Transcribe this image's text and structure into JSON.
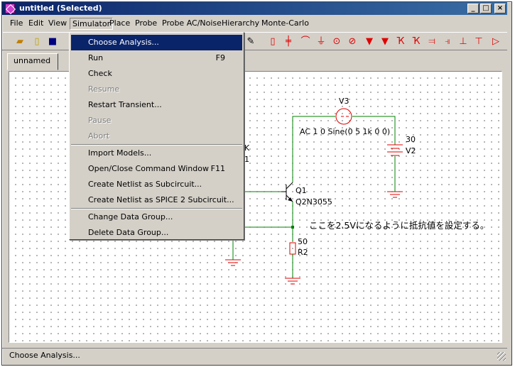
{
  "window": {
    "title": "untitled (Selected)"
  },
  "titlebar_buttons": {
    "minimize": "_",
    "maximize": "□",
    "close": "×"
  },
  "menubar": [
    "File",
    "Edit",
    "View",
    "Simulator",
    "Place",
    "Probe",
    "Probe AC/Noise",
    "Hierarchy",
    "Monte-Carlo"
  ],
  "tab": {
    "label": "unnamed"
  },
  "simulator_menu": {
    "items": [
      {
        "label": "Choose Analysis...",
        "shortcut": "",
        "state": "highlighted"
      },
      {
        "label": "Run",
        "shortcut": "F9",
        "state": "enabled"
      },
      {
        "label": "Check",
        "shortcut": "",
        "state": "enabled"
      },
      {
        "label": "Resume",
        "shortcut": "",
        "state": "disabled"
      },
      {
        "label": "Restart Transient...",
        "shortcut": "",
        "state": "enabled"
      },
      {
        "label": "Pause",
        "shortcut": "",
        "state": "disabled"
      },
      {
        "label": "Abort",
        "shortcut": "",
        "state": "disabled"
      },
      {
        "label": "Import Models...",
        "shortcut": "",
        "state": "enabled"
      },
      {
        "label": "Open/Close Command Window",
        "shortcut": "F11",
        "state": "enabled"
      },
      {
        "label": "Create Netlist as Subcircuit...",
        "shortcut": "",
        "state": "enabled"
      },
      {
        "label": "Create Netlist as SPICE 2 Subcircuit...",
        "shortcut": "",
        "state": "enabled"
      },
      {
        "label": "Change Data Group...",
        "shortcut": "",
        "state": "enabled"
      },
      {
        "label": "Delete Data Group...",
        "shortcut": "",
        "state": "enabled"
      }
    ]
  },
  "schematic": {
    "v3_ref": "V3",
    "v3_value": "AC 1 0 Sine(0 5 1k 0 0)",
    "v2_value": "30",
    "v2_ref": "V2",
    "q1_ref": "Q1",
    "q1_model": "Q2N3055",
    "r2_value": "50",
    "r2_ref": "R2",
    "partial_label_1": "K",
    "partial_label_2": "1",
    "annotation": "ここを2.5Vになるように抵抗値を設定する。"
  },
  "status": {
    "text": "Choose Analysis..."
  },
  "colors": {
    "wire": "#008000",
    "component": "#e00000",
    "highlight": "#0a246a",
    "face": "#d4d0c8"
  },
  "toolbar_icons": [
    "open-folder-icon",
    "new-file-icon",
    "save-icon",
    "pencil-icon",
    "resistor-icon",
    "capacitor-icon",
    "inductor-icon",
    "ground-icon",
    "voltage-source-icon",
    "current-source-icon",
    "diode-icon",
    "zener-icon",
    "transistor-npn-icon",
    "transistor-pnp-icon",
    "jfet-icon",
    "mosfet-n-icon",
    "mosfet-p-icon",
    "mosfet-icon",
    "opamp-icon"
  ]
}
